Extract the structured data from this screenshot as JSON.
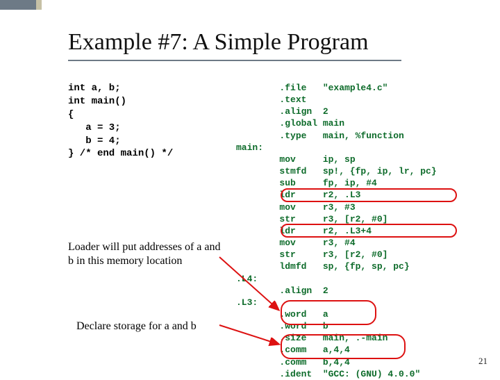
{
  "title": "Example #7: A Simple Program",
  "c_code": "int a, b;\nint main()\n{\n   a = 3;\n   b = 4;\n} /* end main() */",
  "asm": "        .file   \"example4.c\"\n        .text\n        .align  2\n        .global main\n        .type   main, %function\nmain:\n        mov     ip, sp\n        stmfd   sp!, {fp, ip, lr, pc}\n        sub     fp, ip, #4\n        ldr     r2, .L3\n        mov     r3, #3\n        str     r3, [r2, #0]\n        ldr     r2, .L3+4\n        mov     r3, #4\n        str     r3, [r2, #0]\n        ldmfd   sp, {fp, sp, pc}\n.L4:\n        .align  2\n.L3:\n        .word   a\n        .word   b\n        .size   main, .-main\n        .comm   a,4,4\n        .comm   b,4,4\n        .ident  \"GCC: (GNU) 4.0.0\"",
  "note1": "Loader will put addresses of a and b in this memory location",
  "note2": "Declare storage for a and b",
  "pagenum": "21"
}
